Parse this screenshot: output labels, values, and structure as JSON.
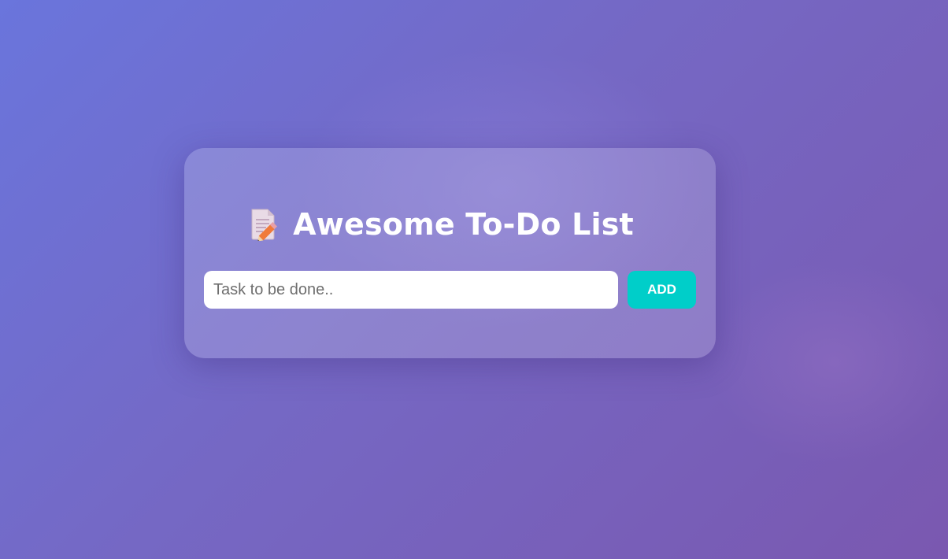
{
  "app": {
    "title": "Awesome To-Do List",
    "title_icon": "memo-pencil-icon"
  },
  "input": {
    "placeholder": "Task to be done..",
    "value": ""
  },
  "add_button": {
    "label": "ADD"
  },
  "colors": {
    "background_start": "#6a75dc",
    "background_end": "#7a58b0",
    "accent": "#00cec9",
    "title_text": "#ffffff"
  }
}
